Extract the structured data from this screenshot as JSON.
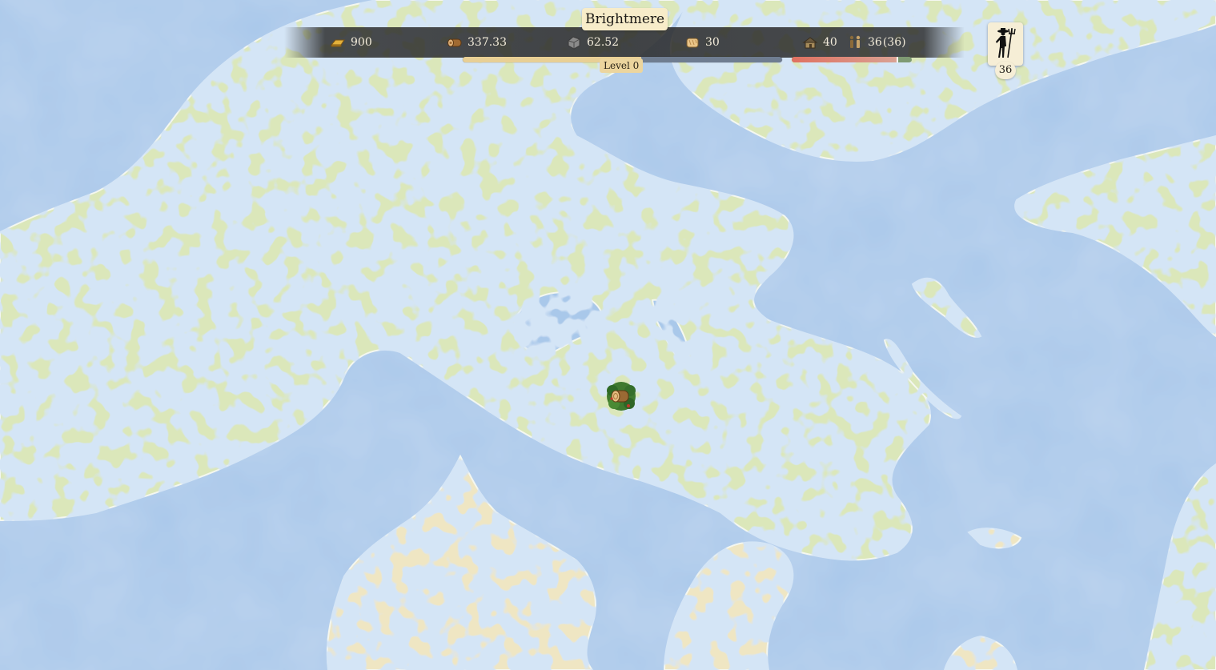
{
  "city": {
    "name": "Brightmere"
  },
  "resources": {
    "gold": {
      "icon": "gold-bar-icon",
      "value": "900"
    },
    "wood": {
      "icon": "wood-log-icon",
      "value": "337.33"
    },
    "stone": {
      "icon": "stone-icon",
      "value": "62.52"
    },
    "food": {
      "icon": "bread-icon",
      "value": "30"
    },
    "housing": {
      "icon": "house-icon",
      "value": "40"
    },
    "population": {
      "icon": "villagers-icon",
      "value": "36",
      "capacity": "(36)"
    }
  },
  "level": {
    "label": "Level 0",
    "progress": 0.56
  },
  "population_bar": {
    "progress": 0.88
  },
  "workers": {
    "icon": "farmer-pitchfork-icon",
    "count": "36"
  },
  "colors": {
    "water": "#a9c8ea",
    "land": "#d9e6b9",
    "sand": "#efe6c3",
    "hud_dark": "#2b2b2b",
    "parchment": "#f6eed6",
    "level_fill": "#e8cf95",
    "pop_fill": "#e07060"
  },
  "map_marker": {
    "icon": "lumber-camp-icon"
  }
}
